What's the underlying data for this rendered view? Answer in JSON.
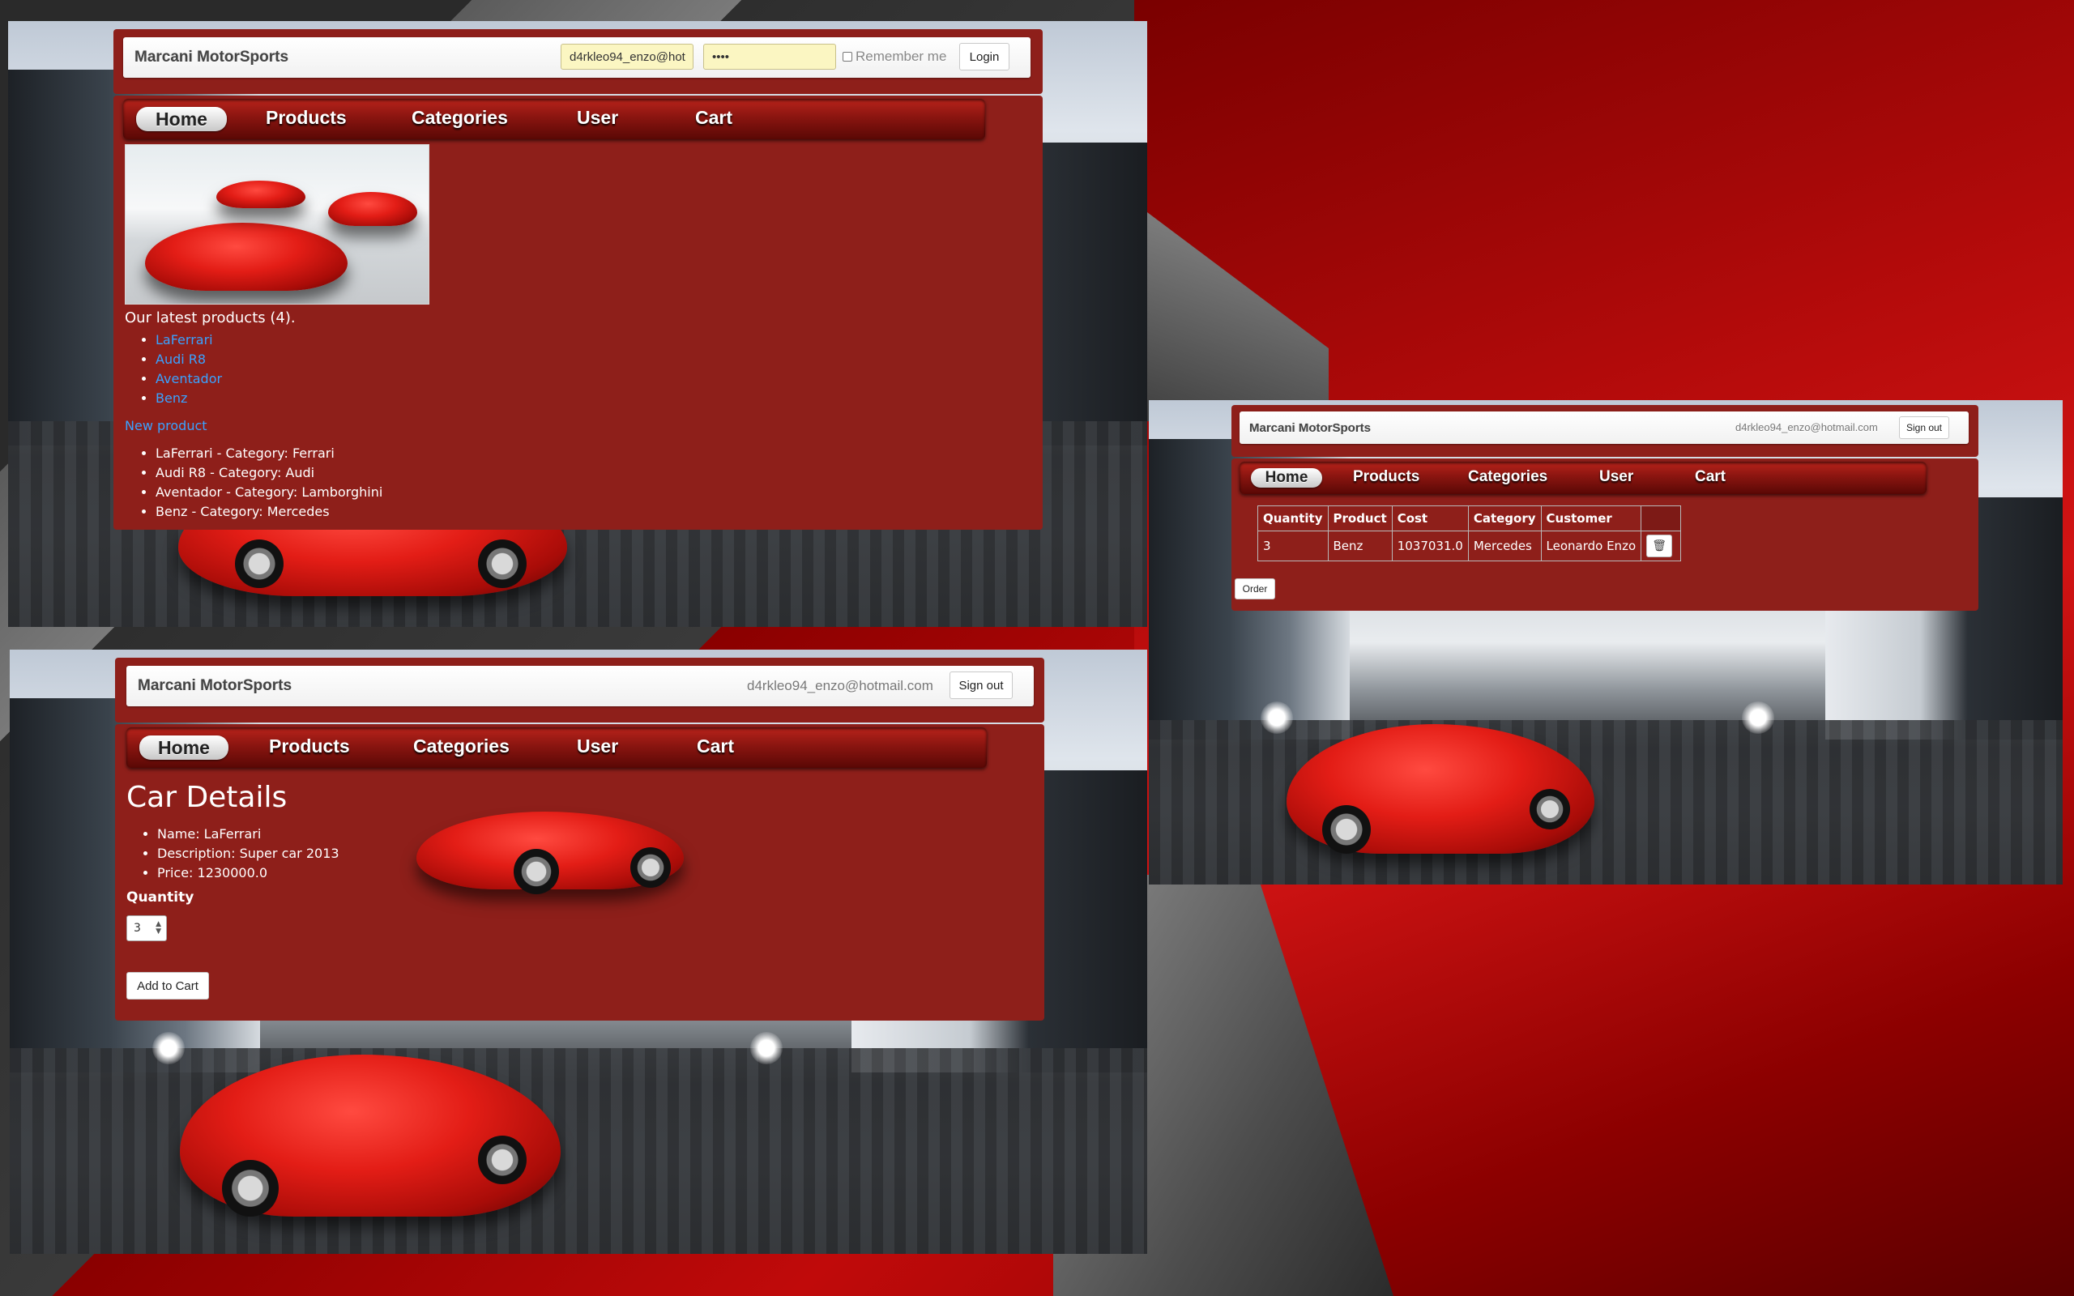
{
  "site": {
    "brand": "Marcani MotorSports"
  },
  "nav": {
    "items": [
      "Home",
      "Products",
      "Categories",
      "User",
      "Cart"
    ]
  },
  "login": {
    "email_value": "d4rkleo94_enzo@hot",
    "password_value": "••••",
    "remember_label": "Remember me",
    "login_label": "Login"
  },
  "session": {
    "user_email": "d4rkleo94_enzo@hotmail.com",
    "signout_label": "Sign out"
  },
  "home": {
    "latest_heading": "Our latest products (4).",
    "latest_products": [
      "LaFerrari",
      "Audi R8",
      "Aventador",
      "Benz"
    ],
    "new_product_link": "New product",
    "product_categories": [
      "LaFerrari - Category: Ferrari",
      "Audi R8 - Category: Audi",
      "Aventador - Category: Lamborghini",
      "Benz - Category: Mercedes"
    ]
  },
  "details": {
    "title": "Car Details",
    "name": "Name: LaFerrari",
    "description": "Description: Super car 2013",
    "price": "Price: 1230000.0",
    "quantity_label": "Quantity",
    "quantity_value": "3",
    "add_to_cart_label": "Add to Cart"
  },
  "cart": {
    "headers": [
      "Quantity",
      "Product",
      "Cost",
      "Category",
      "Customer"
    ],
    "rows": [
      {
        "quantity": "3",
        "product": "Benz",
        "cost": "1037031.0",
        "category": "Mercedes",
        "customer": "Leonardo Enzo"
      }
    ],
    "order_label": "Order"
  },
  "icons": {
    "delete": "trash-icon",
    "dropdown": "spinner-arrows-icon"
  },
  "colors": {
    "panel": "#8e1f1a",
    "nav_gradient_top": "#b8231b",
    "link": "#3aa2ff",
    "input_autofill": "#fbf6c2"
  }
}
